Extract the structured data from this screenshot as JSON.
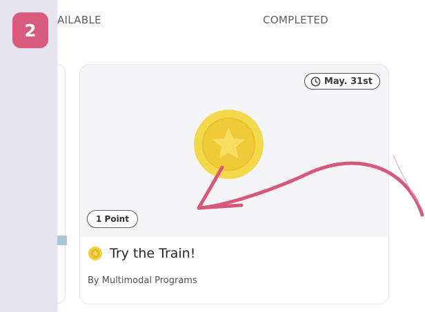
{
  "step_number": "2",
  "tabs": {
    "available_visible_text": "AILABLE",
    "completed": "COMPLETED"
  },
  "card": {
    "date": "May. 31st",
    "points": "1 Point",
    "title": "Try the Train!",
    "author": "By Multimodal Programs"
  },
  "icons": {
    "clock": "clock-icon",
    "coin": "star-coin-icon",
    "annotation": "curved-arrow-icon"
  },
  "colors": {
    "accent_pink": "#d95b7f",
    "coin_gold": "#f2d54a"
  }
}
